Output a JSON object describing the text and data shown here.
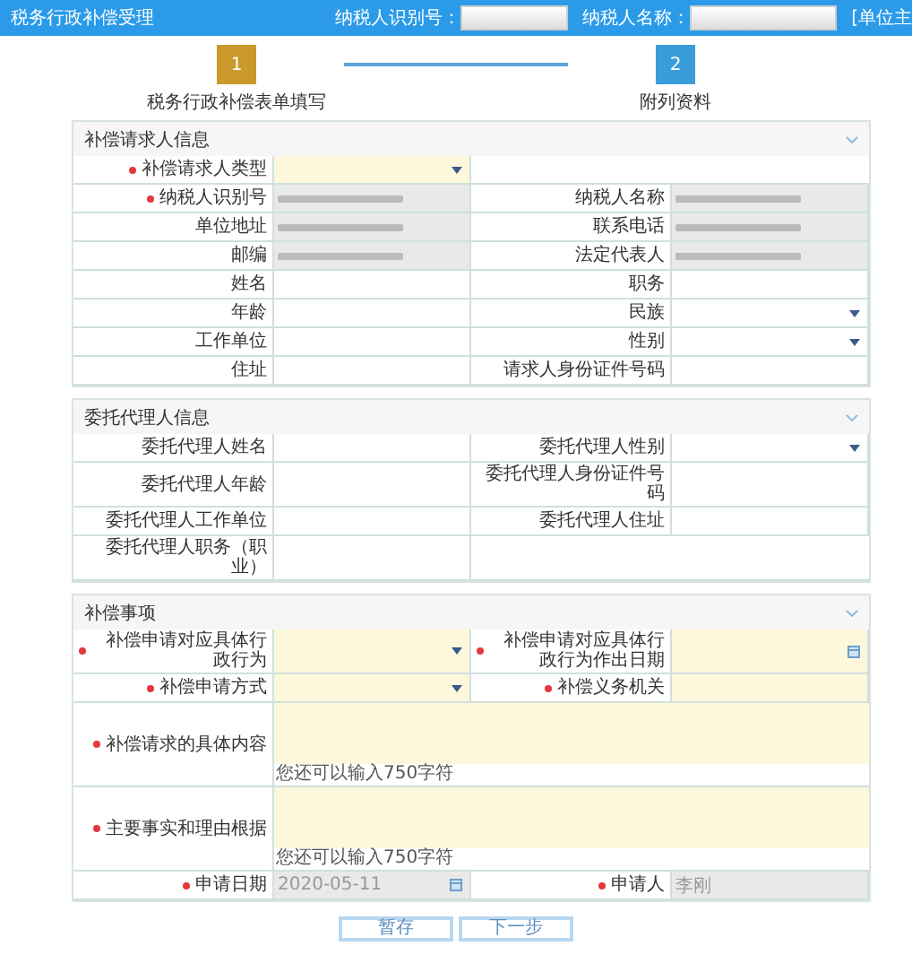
{
  "top_bar": {
    "title": "税务行政补偿受理",
    "taxpayer_id_label": "纳税人识别号：",
    "taxpayer_name_label": "纳税人名称：",
    "cut_text": "[单位主"
  },
  "steps": [
    {
      "number": "1",
      "label": "税务行政补偿表单填写",
      "selected": true
    },
    {
      "number": "2",
      "label": "附列资料",
      "selected": false
    }
  ],
  "sections": [
    {
      "title": "补偿请求人信息",
      "rows": [
        [
          {
            "label": "补偿请求人类型",
            "required": true,
            "readonly": false,
            "kind": "select"
          },
          {
            "kind": "blank"
          }
        ],
        [
          {
            "label": "纳税人识别号",
            "required": true,
            "readonly": true,
            "kind": "text",
            "redacted": true
          },
          {
            "label": "纳税人名称",
            "required": false,
            "readonly": true,
            "kind": "text",
            "redacted": true
          }
        ],
        [
          {
            "label": "单位地址",
            "required": false,
            "readonly": true,
            "kind": "text",
            "redacted": true
          },
          {
            "label": "联系电话",
            "required": false,
            "readonly": true,
            "kind": "text",
            "redacted": true
          }
        ],
        [
          {
            "label": "邮编",
            "required": false,
            "readonly": true,
            "kind": "text",
            "redacted": true
          },
          {
            "label": "法定代表人",
            "required": false,
            "readonly": true,
            "kind": "text",
            "redacted": true
          }
        ],
        [
          {
            "label": "姓名",
            "required": false,
            "readonly": false,
            "kind": "text"
          },
          {
            "label": "职务",
            "required": false,
            "readonly": false,
            "kind": "text"
          }
        ],
        [
          {
            "label": "年龄",
            "required": false,
            "readonly": false,
            "kind": "text"
          },
          {
            "label": "民族",
            "required": false,
            "readonly": false,
            "kind": "select"
          }
        ],
        [
          {
            "label": "工作单位",
            "required": false,
            "readonly": false,
            "kind": "text"
          },
          {
            "label": "性别",
            "required": false,
            "readonly": false,
            "kind": "select"
          }
        ],
        [
          {
            "label": "住址",
            "required": false,
            "readonly": false,
            "kind": "text"
          },
          {
            "label": "请求人身份证件号码",
            "required": false,
            "readonly": false,
            "kind": "text"
          }
        ]
      ]
    },
    {
      "title": "委托代理人信息",
      "rows": [
        [
          {
            "label": "委托代理人姓名",
            "required": false,
            "readonly": false,
            "kind": "text"
          },
          {
            "label": "委托代理人性别",
            "required": false,
            "readonly": false,
            "kind": "select"
          }
        ],
        [
          {
            "label": "委托代理人年龄",
            "required": false,
            "readonly": false,
            "kind": "text"
          },
          {
            "label": "委托代理人身份证件号码",
            "required": false,
            "readonly": false,
            "kind": "text"
          }
        ],
        [
          {
            "label": "委托代理人工作单位",
            "required": false,
            "readonly": false,
            "kind": "text"
          },
          {
            "label": "委托代理人住址",
            "required": false,
            "readonly": false,
            "kind": "text"
          }
        ],
        [
          {
            "label": "委托代理人职务（职业）",
            "required": false,
            "readonly": false,
            "kind": "text"
          },
          {
            "kind": "blank"
          }
        ]
      ]
    },
    {
      "title": "补偿事项",
      "rows": [
        [
          {
            "label": "补偿申请对应具体行政行为",
            "required": true,
            "readonly": false,
            "kind": "select"
          },
          {
            "label": "补偿申请对应具体行政行为作出日期",
            "required": true,
            "readonly": false,
            "kind": "date"
          }
        ],
        [
          {
            "label": "补偿申请方式",
            "required": true,
            "readonly": false,
            "kind": "select"
          },
          {
            "label": "补偿义务机关",
            "required": true,
            "readonly": false,
            "kind": "text"
          }
        ],
        [
          {
            "label": "补偿请求的具体内容",
            "required": true,
            "kind": "textarea",
            "hint": "您还可以输入750字符"
          }
        ],
        [
          {
            "label": "主要事实和理由根据",
            "required": true,
            "kind": "textarea",
            "hint": "您还可以输入750字符"
          }
        ],
        [
          {
            "label": "申请日期",
            "required": true,
            "readonly": true,
            "kind": "date",
            "value": "2020-05-11"
          },
          {
            "label": "申请人",
            "required": true,
            "readonly": true,
            "kind": "text",
            "value": "李刚"
          }
        ]
      ]
    }
  ],
  "buttons": [
    {
      "label": "暂存"
    },
    {
      "label": "下一步"
    }
  ]
}
